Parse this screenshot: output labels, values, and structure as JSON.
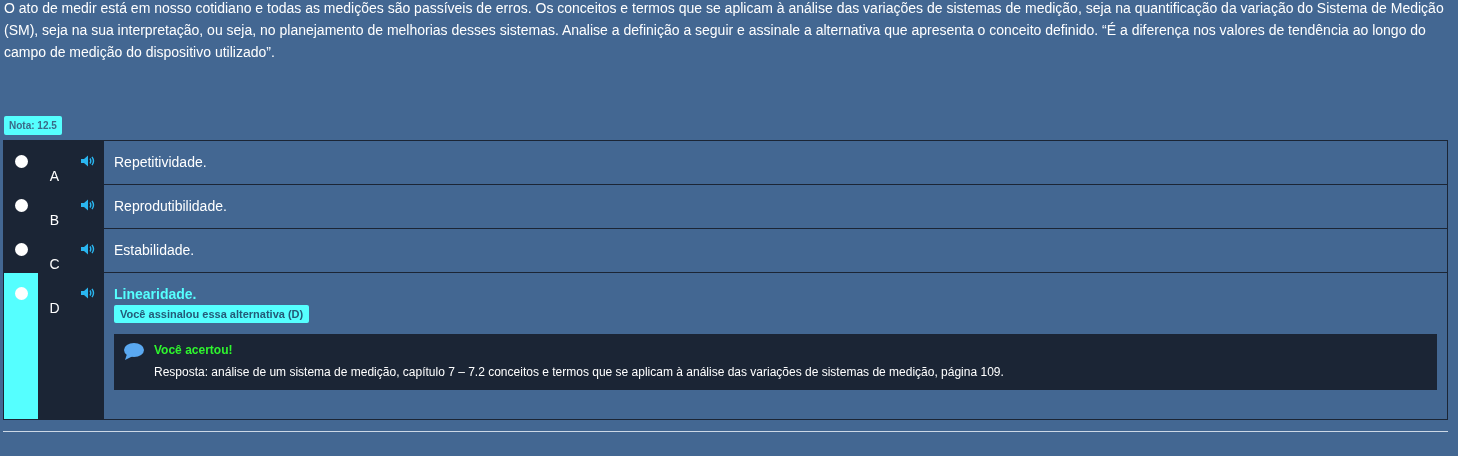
{
  "question": "O ato de medir está em nosso cotidiano e todas as medições são passíveis de erros. Os conceitos e termos que se aplicam à análise das variações de sistemas de medição, seja na quantificação da variação do Sistema de Medição (SM), seja na sua interpretação, ou seja, no planejamento de melhorias desses sistemas. Analise a definição a seguir e assinale a alternativa que apresenta o conceito definido. “É a diferença nos valores de tendência ao longo do campo de medição do dispositivo utilizado”.",
  "grade": "Nota: 12.5",
  "options": [
    {
      "letter": "A",
      "text": "Repetitividade.",
      "selected": false
    },
    {
      "letter": "B",
      "text": "Reprodutibilidade.",
      "selected": false
    },
    {
      "letter": "C",
      "text": "Estabilidade.",
      "selected": false
    },
    {
      "letter": "D",
      "text": "Linearidade.",
      "selected": true,
      "note": "Você assinalou essa alternativa (D)",
      "feedback": {
        "title": "Você acertou!",
        "text": "Resposta: análise de um sistema de medição, capítulo 7 – 7.2 conceitos e termos que se aplicam à análise das variações de sistemas de medição, página 109."
      }
    }
  ]
}
